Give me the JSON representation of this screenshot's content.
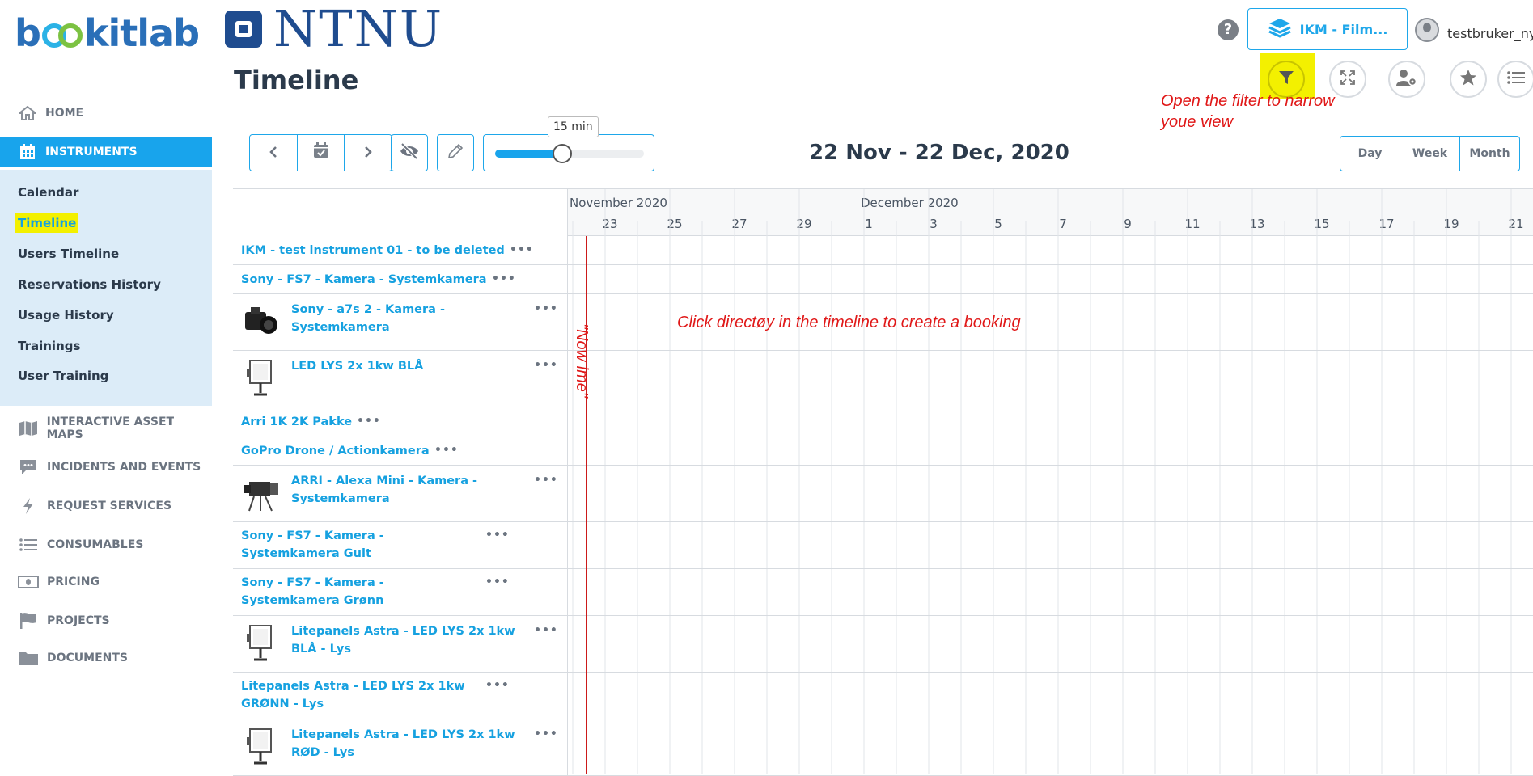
{
  "brand": {
    "logo_prefix": "b",
    "logo_suffix": "kitlab",
    "org_name": "NTNU"
  },
  "header": {
    "facility": "IKM - Film...",
    "user": "testbruker_ny",
    "help_icon": "question-circle-icon",
    "title": "Timeline"
  },
  "sidebar": {
    "home": "HOME",
    "instruments": "INSTRUMENTS",
    "sub": [
      "Calendar",
      "Timeline",
      "Users Timeline",
      "Reservations History",
      "Usage History",
      "Trainings",
      "User Training"
    ],
    "lower": [
      "INTERACTIVE ASSET MAPS",
      "INCIDENTS AND EVENTS",
      "REQUEST SERVICES",
      "CONSUMABLES",
      "PRICING",
      "PROJECTS",
      "DOCUMENTS"
    ]
  },
  "toolbar": {
    "zoom_label": "15 min",
    "zoom_level": 0.45,
    "date_range": "22 Nov - 22 Dec, 2020",
    "views": [
      "Day",
      "Week",
      "Month"
    ]
  },
  "timeline": {
    "months": [
      "November 2020",
      "December 2020"
    ],
    "days": [
      "23",
      "25",
      "27",
      "29",
      "1",
      "3",
      "5",
      "7",
      "9",
      "11",
      "13",
      "15",
      "17",
      "19",
      "21"
    ],
    "rows": [
      {
        "name": "IKM - test instrument 01 - to be deleted",
        "dots": "•••"
      },
      {
        "name": "Sony - FS7 - Kamera - Systemkamera",
        "dots": "•••"
      },
      {
        "name": "Sony - a7s 2 - Kamera - Systemkamera",
        "dots": "•••"
      },
      {
        "name": "LED LYS 2x 1kw BLÅ",
        "dots": "•••"
      },
      {
        "name": "Arri 1K 2K Pakke",
        "dots": "•••"
      },
      {
        "name": "GoPro Drone / Actionkamera",
        "dots": "•••"
      },
      {
        "name": "ARRI - Alexa Mini - Kamera - Systemkamera",
        "dots": "•••"
      },
      {
        "name": "Sony - FS7 - Kamera - Systemkamera Gult",
        "dots": "•••"
      },
      {
        "name": "Sony - FS7 - Kamera - Systemkamera Grønn",
        "dots": "•••"
      },
      {
        "name": "Litepanels Astra - LED LYS 2x 1kw BLÅ - Lys",
        "dots": "•••"
      },
      {
        "name": "Litepanels Astra - LED LYS 2x 1kw GRØNN - Lys",
        "dots": "•••"
      },
      {
        "name": "Litepanels Astra - LED LYS 2x 1kw RØD - Lys",
        "dots": "•••"
      }
    ]
  },
  "annotations": {
    "filter": "Open the filter to narrow youe view",
    "click": "Click directøy in the timeline to create a booking",
    "now": "\"Now ime\""
  },
  "colors": {
    "accent": "#18a4ec",
    "highlight": "#f3f000",
    "annotation": "#e01818"
  }
}
